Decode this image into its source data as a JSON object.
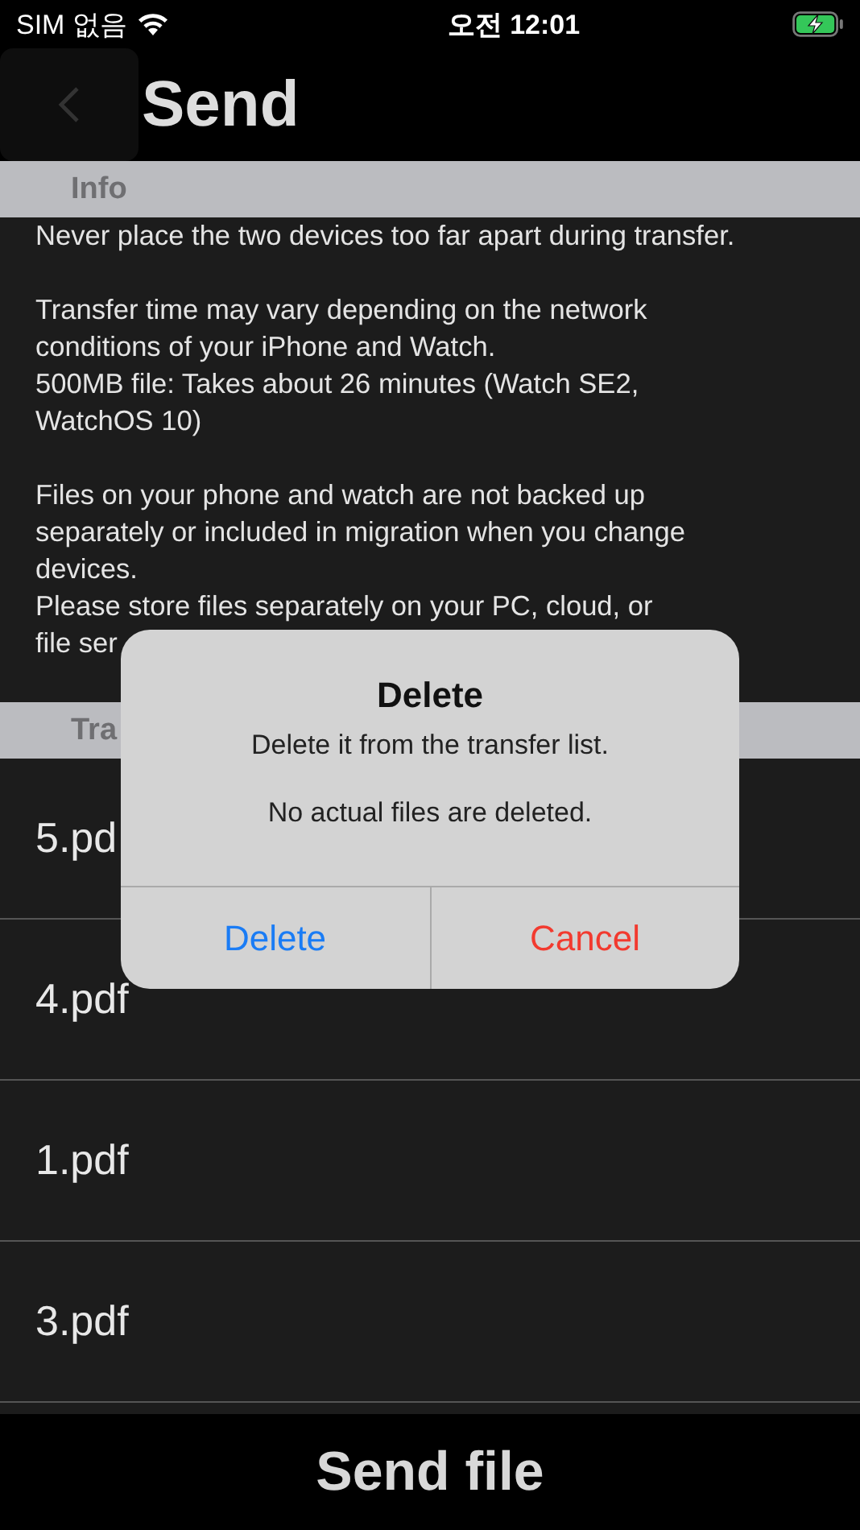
{
  "status_bar": {
    "carrier": "SIM 없음",
    "time": "오전 12:01"
  },
  "header": {
    "title": "Send"
  },
  "info_section": {
    "title": "Info",
    "paragraphs": [
      [
        "Never place the two devices too far apart during transfer."
      ],
      [
        "Transfer time may vary depending on the network",
        "conditions of your iPhone and Watch.",
        "500MB file: Takes about 26 minutes (Watch SE2,",
        "WatchOS 10)"
      ],
      [
        "Files on your phone and watch are not backed up",
        "separately or included in migration when you change",
        "devices.",
        "Please store files separately on your PC, cloud, or",
        "file ser"
      ]
    ]
  },
  "transfer_section": {
    "title": "Tra",
    "rows": [
      "5.pd",
      "4.pdf",
      "1.pdf",
      "3.pdf"
    ]
  },
  "bottom_button": "Send file",
  "dialog": {
    "title": "Delete",
    "messages": [
      "Delete it from the transfer list.",
      "No actual files are deleted."
    ],
    "buttons": [
      {
        "label": "Delete",
        "kind": "default"
      },
      {
        "label": "Cancel",
        "kind": "destructive"
      }
    ]
  }
}
